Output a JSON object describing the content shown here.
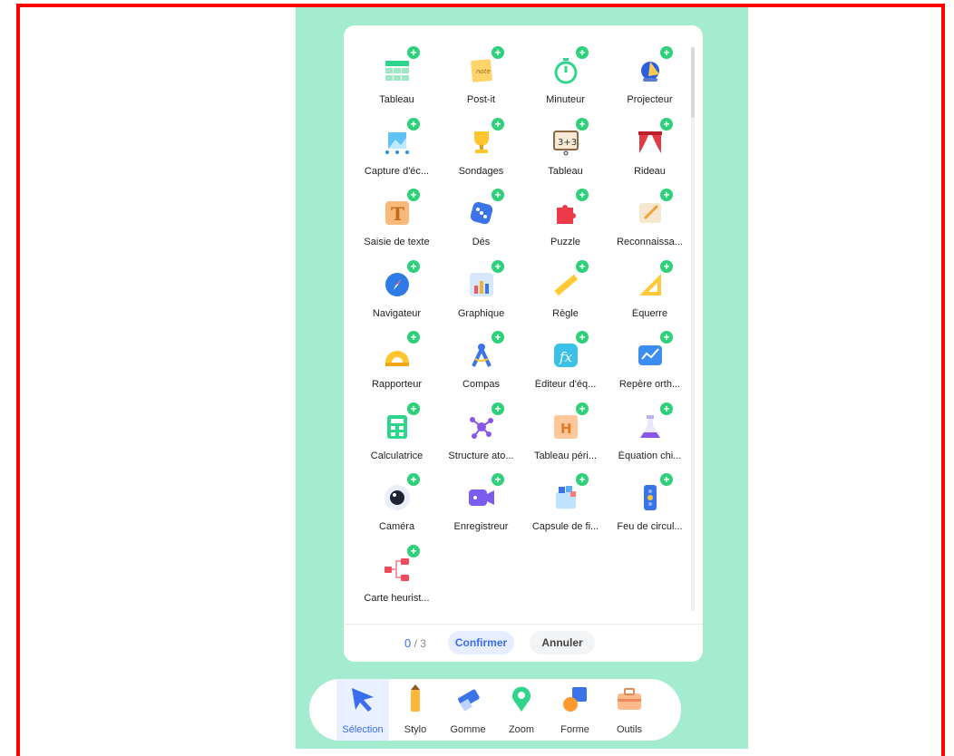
{
  "tools": [
    {
      "label": "Tableau",
      "icon": "table-icon"
    },
    {
      "label": "Post-it",
      "icon": "sticky-note-icon"
    },
    {
      "label": "Minuteur",
      "icon": "timer-icon"
    },
    {
      "label": "Projecteur",
      "icon": "spotlight-icon"
    },
    {
      "label": "Capture d'éc...",
      "icon": "screenshot-icon"
    },
    {
      "label": "Sondages",
      "icon": "trophy-icon"
    },
    {
      "label": "Tableau",
      "icon": "scoreboard-icon"
    },
    {
      "label": "Rideau",
      "icon": "curtain-icon"
    },
    {
      "label": "Saisie de texte",
      "icon": "text-icon"
    },
    {
      "label": "Dés",
      "icon": "dice-icon"
    },
    {
      "label": "Puzzle",
      "icon": "puzzle-icon"
    },
    {
      "label": "Reconnaissa...",
      "icon": "handwriting-icon"
    },
    {
      "label": "Navigateur",
      "icon": "compass-browser-icon"
    },
    {
      "label": "Graphique",
      "icon": "bar-chart-icon"
    },
    {
      "label": "Règle",
      "icon": "ruler-icon"
    },
    {
      "label": "Équerre",
      "icon": "set-square-icon"
    },
    {
      "label": "Rapporteur",
      "icon": "protractor-icon"
    },
    {
      "label": "Compas",
      "icon": "drawing-compass-icon"
    },
    {
      "label": "Éditeur d'éq...",
      "icon": "formula-icon"
    },
    {
      "label": "Repère orth...",
      "icon": "coordinate-icon"
    },
    {
      "label": "Calculatrice",
      "icon": "calculator-icon"
    },
    {
      "label": "Structure ato...",
      "icon": "molecule-icon"
    },
    {
      "label": "Tableau péri...",
      "icon": "periodic-table-icon"
    },
    {
      "label": "Équation chi...",
      "icon": "flask-icon"
    },
    {
      "label": "Caméra",
      "icon": "camera-icon"
    },
    {
      "label": "Enregistreur",
      "icon": "recorder-icon"
    },
    {
      "label": "Capsule de fi...",
      "icon": "file-capsule-icon"
    },
    {
      "label": "Feu de circul...",
      "icon": "traffic-light-icon"
    },
    {
      "label": "Carte heurist...",
      "icon": "mind-map-icon"
    }
  ],
  "footer": {
    "count_current": "0",
    "count_total": "/ 3",
    "confirm_label": "Confirmer",
    "cancel_label": "Annuler"
  },
  "dock": [
    {
      "label": "Sélection",
      "icon": "cursor-icon",
      "active": true
    },
    {
      "label": "Stylo",
      "icon": "pencil-icon",
      "active": false
    },
    {
      "label": "Gomme",
      "icon": "eraser-icon",
      "active": false
    },
    {
      "label": "Zoom",
      "icon": "zoom-pin-icon",
      "active": false
    },
    {
      "label": "Forme",
      "icon": "shapes-icon",
      "active": false
    },
    {
      "label": "Outils",
      "icon": "toolbox-icon",
      "active": false
    }
  ],
  "colors": {
    "accent": "#3a6df0",
    "add_badge": "#2ed17a",
    "background": "#a3ecd0"
  }
}
